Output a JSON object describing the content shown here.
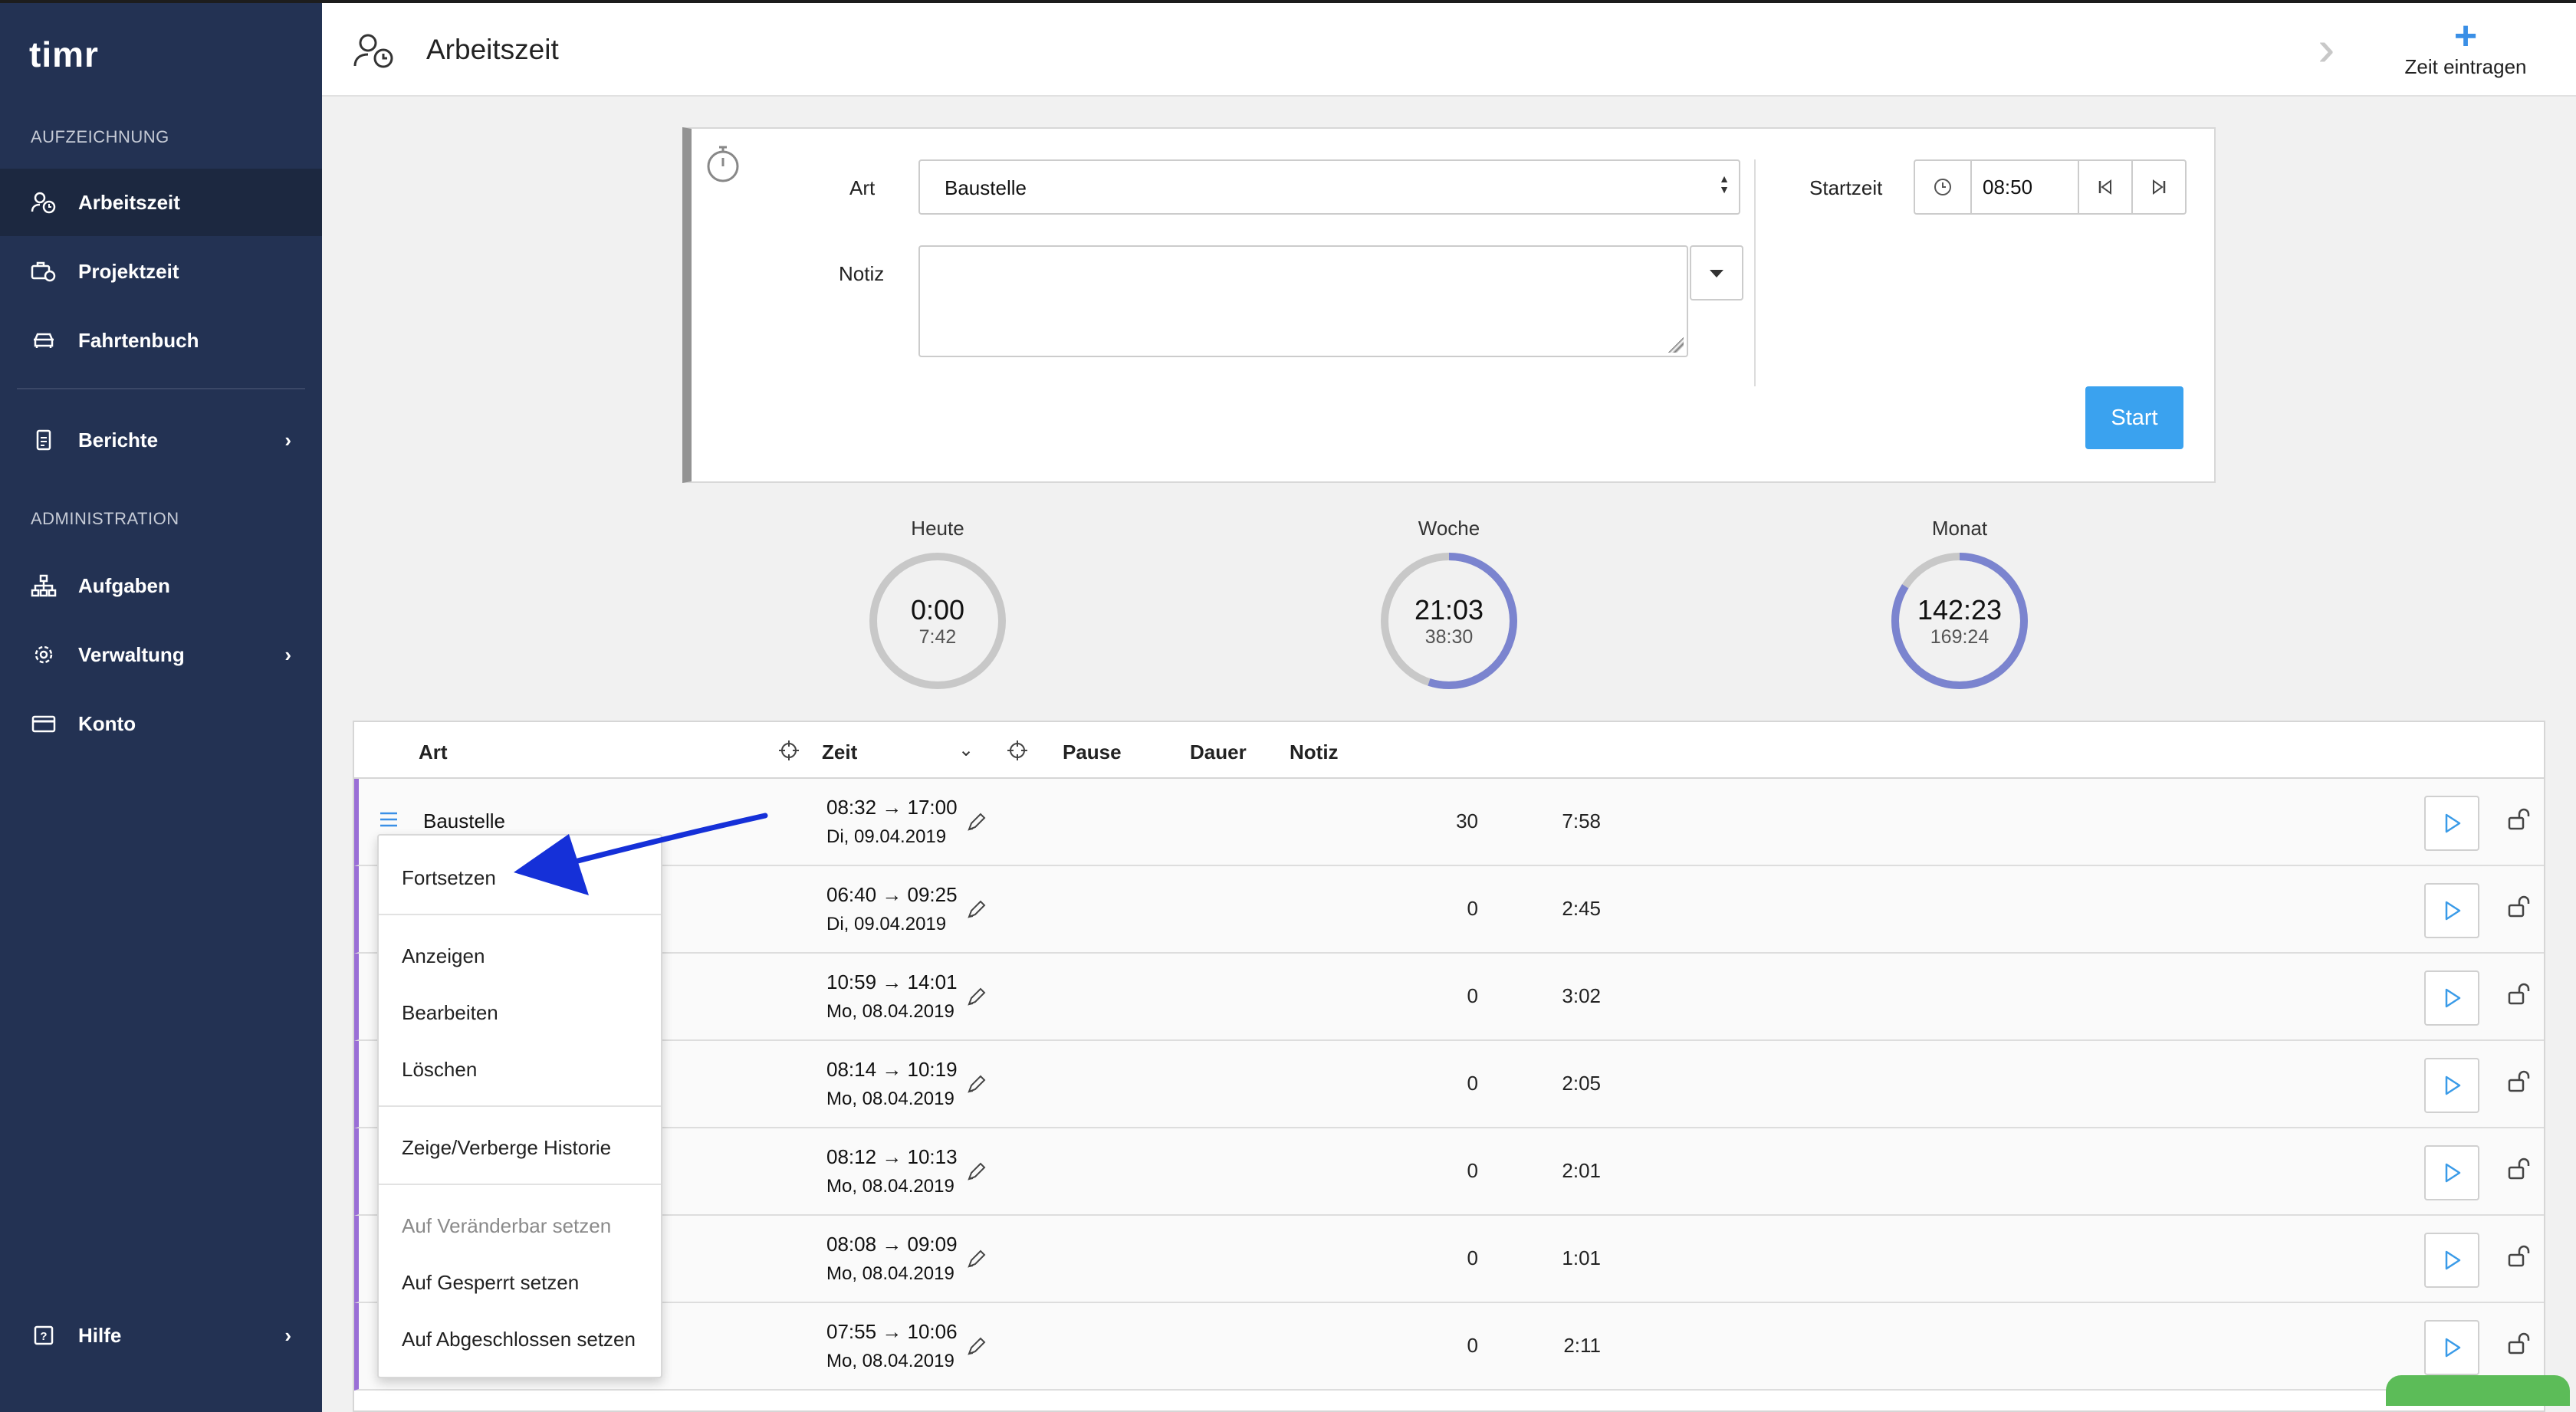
{
  "brand": {
    "logo_text": "timr"
  },
  "sidebar": {
    "section_record": "AUFZEICHNUNG",
    "section_admin": "ADMINISTRATION",
    "items": [
      {
        "label": "Arbeitszeit",
        "icon": "person-clock-icon",
        "active": true
      },
      {
        "label": "Projektzeit",
        "icon": "briefcase-clock-icon"
      },
      {
        "label": "Fahrtenbuch",
        "icon": "car-icon"
      },
      {
        "label": "Berichte",
        "icon": "report-icon",
        "chevron": true
      },
      {
        "label": "Aufgaben",
        "icon": "hierarchy-icon"
      },
      {
        "label": "Verwaltung",
        "icon": "gear-icon",
        "chevron": true
      },
      {
        "label": "Konto",
        "icon": "credit-card-icon"
      },
      {
        "label": "Hilfe",
        "icon": "help-icon",
        "chevron": true
      }
    ]
  },
  "header": {
    "title": "Arbeitszeit",
    "add_label": "Zeit eintragen"
  },
  "form": {
    "art_label": "Art",
    "art_value": "Baustelle",
    "notiz_label": "Notiz",
    "notiz_value": "",
    "startzeit_label": "Startzeit",
    "startzeit_value": "08:50",
    "start_button": "Start"
  },
  "stats": [
    {
      "label": "Heute",
      "value": "0:00",
      "target": "7:42",
      "progress": 0
    },
    {
      "label": "Woche",
      "value": "21:03",
      "target": "38:30",
      "progress": 0.55
    },
    {
      "label": "Monat",
      "value": "142:23",
      "target": "169:24",
      "progress": 0.84
    }
  ],
  "table": {
    "headers": {
      "art": "Art",
      "zeit": "Zeit",
      "pause": "Pause",
      "dauer": "Dauer",
      "notiz": "Notiz"
    },
    "rows": [
      {
        "art": "Baustelle",
        "range": "08:32 → 17:00",
        "date": "Di, 09.04.2019",
        "pause": "30",
        "dauer": "7:58"
      },
      {
        "art": "",
        "range": "06:40 → 09:25",
        "date": "Di, 09.04.2019",
        "pause": "0",
        "dauer": "2:45"
      },
      {
        "art": "",
        "range": "10:59 → 14:01",
        "date": "Mo, 08.04.2019",
        "pause": "0",
        "dauer": "3:02"
      },
      {
        "art": "",
        "range": "08:14 → 10:19",
        "date": "Mo, 08.04.2019",
        "pause": "0",
        "dauer": "2:05"
      },
      {
        "art": "",
        "range": "08:12 → 10:13",
        "date": "Mo, 08.04.2019",
        "pause": "0",
        "dauer": "2:01"
      },
      {
        "art": "",
        "range": "08:08 → 09:09",
        "date": "Mo, 08.04.2019",
        "pause": "0",
        "dauer": "1:01"
      },
      {
        "art": "",
        "range": "07:55 → 10:06",
        "date": "Mo, 08.04.2019",
        "pause": "0",
        "dauer": "2:11"
      }
    ]
  },
  "context_menu": {
    "items": [
      {
        "label": "Fortsetzen"
      },
      {
        "label": "Anzeigen"
      },
      {
        "label": "Bearbeiten"
      },
      {
        "label": "Löschen"
      },
      {
        "label": "Zeige/Verberge Historie"
      },
      {
        "label": "Auf Veränderbar setzen",
        "disabled": true
      },
      {
        "label": "Auf Gesperrt setzen"
      },
      {
        "label": "Auf Abgeschlossen setzen"
      }
    ]
  },
  "colors": {
    "sidebar": "#233253",
    "accent": "#3aa2ef",
    "ring": "#7b84cf",
    "row_marker": "#9a6fd6",
    "annotation_arrow": "#1530d8"
  }
}
